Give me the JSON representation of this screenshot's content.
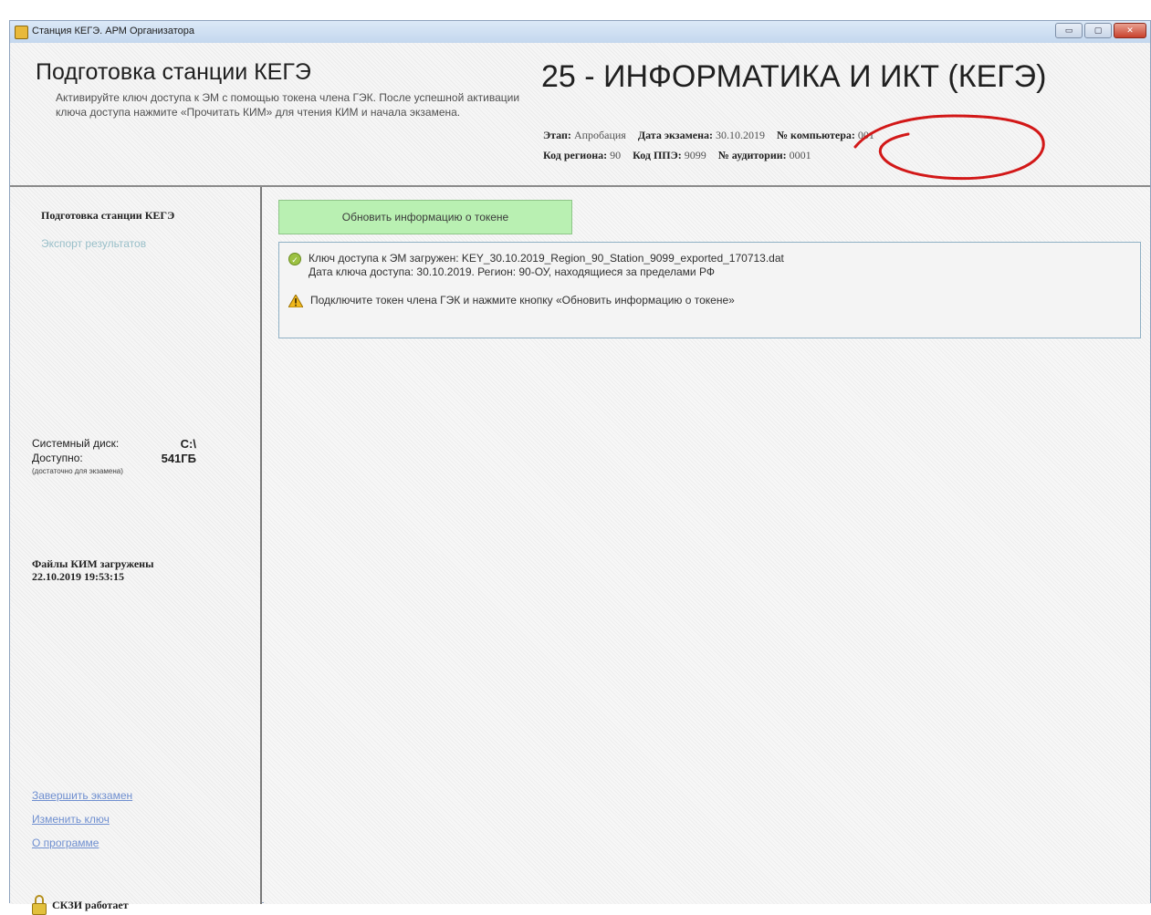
{
  "window": {
    "title": "Станция КЕГЭ. АРМ Организатора",
    "controls": {
      "minimize": "▭",
      "maximize": "▢",
      "close": "✕"
    }
  },
  "header": {
    "title": "Подготовка станции КЕГЭ",
    "description": "Активируйте ключ доступа к ЭМ с помощью токена члена ГЭК. После успешной активации ключа доступа нажмите «Прочитать КИМ» для чтения КИМ и начала экзамена.",
    "subject": "25 - ИНФОРМАТИКА И ИКТ (КЕГЭ)",
    "meta": {
      "stage_label": "Этап:",
      "stage_value": "Апробация",
      "exam_date_label": "Дата экзамена:",
      "exam_date_value": "30.10.2019",
      "computer_label": "№ компьютера:",
      "computer_value": "001",
      "region_label": "Код региона:",
      "region_value": "90",
      "ppe_label": "Код ППЭ:",
      "ppe_value": "9099",
      "auditorium_label": "№ аудитории:",
      "auditorium_value": "0001"
    },
    "annotation_color": "#d21818"
  },
  "sidebar": {
    "title": "Подготовка станции КЕГЭ",
    "export_link": "Экспорт результатов",
    "disk": {
      "system_label": "Системный диск:",
      "system_value": "C:\\",
      "available_label": "Доступно:",
      "available_value": "541ГБ",
      "note": "(достаточно для экзамена)"
    },
    "kim_status": {
      "line1": "Файлы КИМ загружены",
      "line2": "22.10.2019 19:53:15"
    },
    "links": {
      "finish": "Завершить экзамен",
      "change_key": "Изменить ключ",
      "about": "О программе"
    },
    "skzi": "СКЗИ работает"
  },
  "main": {
    "refresh_button": "Обновить информацию о токене",
    "messages": {
      "key_loaded": "Ключ доступа к ЭМ загружен: KEY_30.10.2019_Region_90_Station_9099_exported_170713.dat",
      "key_date": "Дата ключа доступа: 30.10.2019. Регион: 90-ОУ, находящиеся за пределами РФ",
      "connect_token": "Подключите токен члена ГЭК и нажмите кнопку «Обновить информацию о токене»"
    }
  }
}
